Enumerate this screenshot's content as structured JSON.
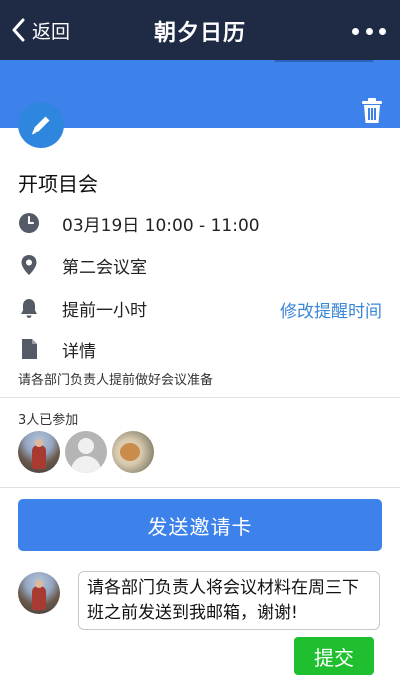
{
  "header": {
    "back_label": "返回",
    "title": "朝夕日历",
    "back_icon": "chevron-left-icon",
    "more_icon": "more-dots-icon",
    "bg_color": "#1f2a44"
  },
  "event": {
    "title": "开项目会",
    "time": "03月19日 10:00 - 11:00",
    "location": "第二会议室",
    "reminder": "提前一小时",
    "modify_reminder_label": "修改提醒时间",
    "detail_label": "详情",
    "detail_text": "请各部门负责人提前做好会议准备",
    "icons": [
      "pencil-icon",
      "trash-icon",
      "clock-icon",
      "location-pin-icon",
      "bell-icon",
      "document-icon"
    ]
  },
  "participants": {
    "label": "3人已参加",
    "count": 3
  },
  "actions": {
    "send_invite_label": "发送邀请卡",
    "submit_label": "提交"
  },
  "comment": {
    "value": "请各部门负责人将会议材料在周三下班之前发送到我邮箱，谢谢!"
  },
  "colors": {
    "accent": "#3d82ea",
    "link": "#3b86d6",
    "submit": "#1fbf2f"
  }
}
